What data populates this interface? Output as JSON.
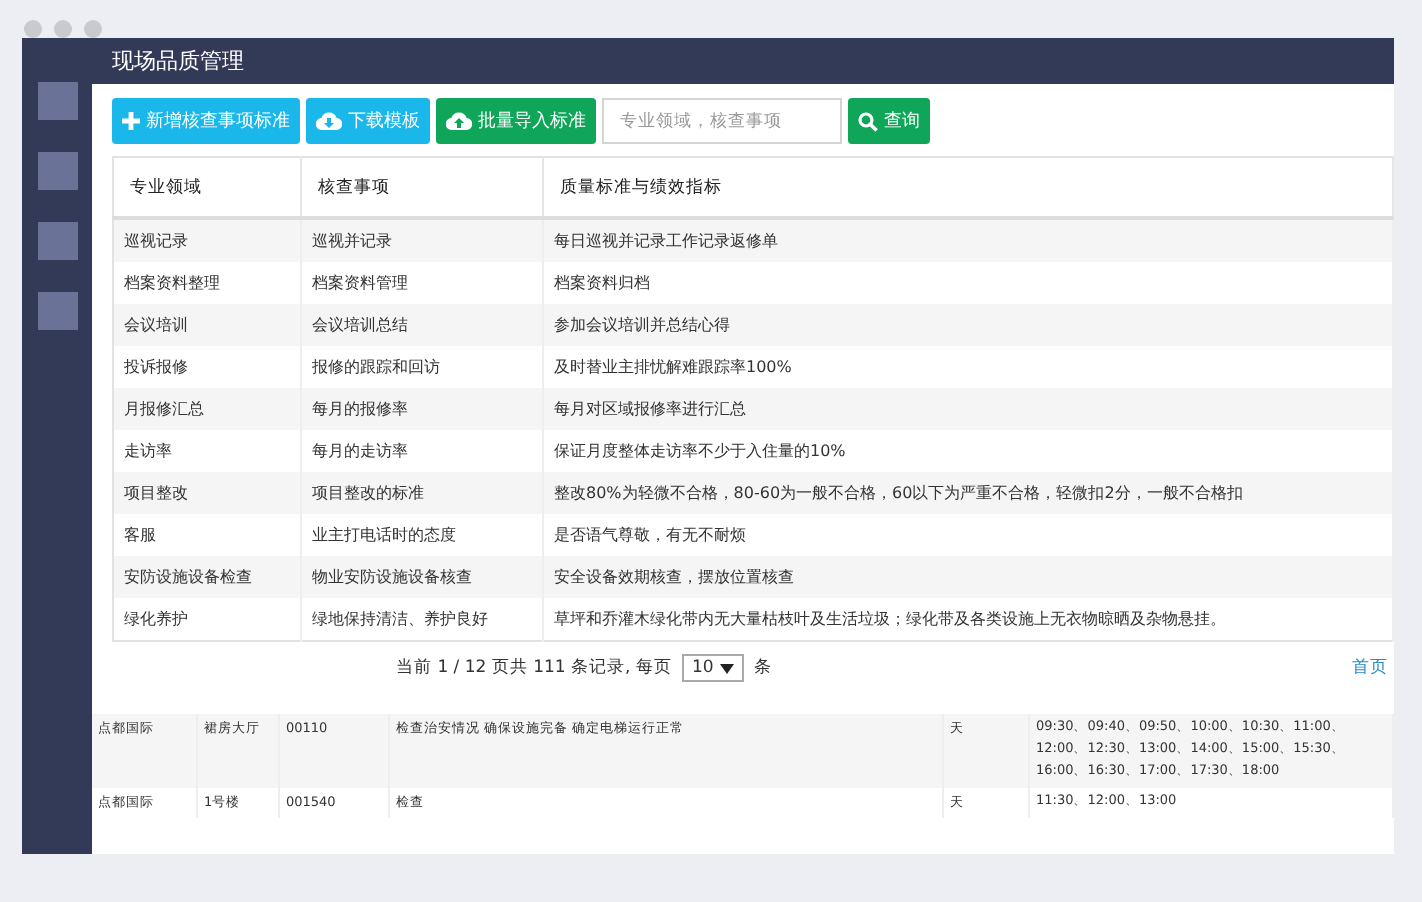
{
  "window": {
    "title": "现场品质管理"
  },
  "toolbar": {
    "buttons": [
      {
        "label": "新增核查事项标准",
        "kind": "add"
      },
      {
        "label": "下载模板",
        "kind": "download"
      },
      {
        "label": "批量导入标准",
        "kind": "import"
      }
    ],
    "search": {
      "placeholder": "专业领域，核查事项"
    },
    "query_button": "查询"
  },
  "table": {
    "columns": [
      "专业领域",
      "核查事项",
      "质量标准与绩效指标"
    ],
    "rows": [
      [
        "巡视记录",
        "巡视并记录",
        "每日巡视并记录工作记录返修单"
      ],
      [
        "档案资料整理",
        "档案资料管理",
        "档案资料归档"
      ],
      [
        "会议培训",
        "会议培训总结",
        "参加会议培训并总结心得"
      ],
      [
        "投诉报修",
        "报修的跟踪和回访",
        "及时替业主排忧解难跟踪率100%"
      ],
      [
        "月报修汇总",
        "每月的报修率",
        "每月对区域报修率进行汇总"
      ],
      [
        "走访率",
        "每月的走访率",
        "保证月度整体走访率不少于入住量的10%"
      ],
      [
        "项目整改",
        "项目整改的标准",
        "整改80%为轻微不合格，80-60为一般不合格，60以下为严重不合格，轻微扣2分，一般不合格扣"
      ],
      [
        "客服",
        "业主打电话时的态度",
        "是否语气尊敬，有无不耐烦"
      ],
      [
        "安防设施设备检查",
        "物业安防设施设备核查",
        "安全设备效期核查，摆放位置核查"
      ],
      [
        "绿化养护",
        "绿地保持清洁、养护良好",
        "草坪和乔灌木绿化带内无大量枯枝叶及生活垃圾；绿化带及各类设施上无衣物晾晒及杂物悬挂。"
      ]
    ]
  },
  "pagination": {
    "summary": "当前 1 / 12 页共 111 条记录, 每页",
    "page_size": "10",
    "unit": "条",
    "first_link": "首页"
  },
  "schedule_table": {
    "rows": [
      [
        "点都国际",
        "裙房大厅",
        "00110",
        "检查治安情况 确保设施完备 确定电梯运行正常",
        "天",
        "09:30、09:40、09:50、10:00、10:30、11:00、12:00、12:30、13:00、14:00、15:00、15:30、16:00、16:30、17:00、17:30、18:00"
      ],
      [
        "点都国际",
        "1号楼",
        "001540",
        "检查",
        "天",
        "11:30、12:00、13:00"
      ]
    ]
  }
}
